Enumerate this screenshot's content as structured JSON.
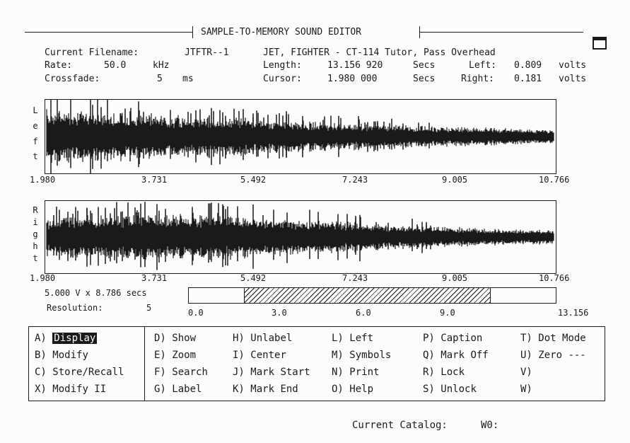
{
  "header": {
    "title": "SAMPLE-TO-MEMORY SOUND EDITOR"
  },
  "info": {
    "filename_label": "Current Filename:",
    "filename_value": "JTFTR--1",
    "description": "JET, FIGHTER - CT-114 Tutor, Pass Overhead",
    "rate_label": "Rate:",
    "rate_value": "50.0",
    "rate_unit": "kHz",
    "length_label": "Length:",
    "length_value": "13.156 920",
    "length_unit": "Secs",
    "left_label": "Left:",
    "left_value": "0.809",
    "left_unit": "volts",
    "crossfade_label": "Crossfade:",
    "crossfade_value": "5",
    "crossfade_unit": "ms",
    "cursor_label": "Cursor:",
    "cursor_value": "1.980 000",
    "cursor_unit": "Secs",
    "right_label": "Right:",
    "right_value": "0.181",
    "right_unit": "volts"
  },
  "channels": {
    "left_letters": [
      "L",
      "e",
      "f",
      "t"
    ],
    "right_letters": [
      "R",
      "i",
      "g",
      "h",
      "t"
    ],
    "ticks": [
      "1.980",
      "3.731",
      "5.492",
      "7.243",
      "9.005",
      "10.766"
    ]
  },
  "overview": {
    "scale_text": "5.000 V x 8.786 secs",
    "resolution_label": "Resolution:",
    "resolution_value": "5",
    "ticks": [
      "0.0",
      "3.0",
      "6.0",
      "9.0",
      "13.156"
    ],
    "total": 13.156,
    "view_start": 1.98,
    "view_end": 10.766
  },
  "menu": {
    "columns": [
      [
        {
          "key": "A)",
          "label": "Display",
          "selected": true
        },
        {
          "key": "B)",
          "label": "Modify"
        },
        {
          "key": "C)",
          "label": "Store/Recall"
        },
        {
          "key": "X)",
          "label": "Modify II"
        }
      ],
      [
        {
          "key": "D)",
          "label": "Show"
        },
        {
          "key": "E)",
          "label": "Zoom"
        },
        {
          "key": "F)",
          "label": "Search"
        },
        {
          "key": "G)",
          "label": "Label"
        }
      ],
      [
        {
          "key": "H)",
          "label": "Unlabel"
        },
        {
          "key": "I)",
          "label": "Center"
        },
        {
          "key": "J)",
          "label": "Mark Start"
        },
        {
          "key": "K)",
          "label": "Mark End"
        }
      ],
      [
        {
          "key": "L)",
          "label": "Left"
        },
        {
          "key": "M)",
          "label": "Symbols"
        },
        {
          "key": "N)",
          "label": "Print"
        },
        {
          "key": "O)",
          "label": "Help"
        }
      ],
      [
        {
          "key": "P)",
          "label": "Caption"
        },
        {
          "key": "Q)",
          "label": "Mark Off"
        },
        {
          "key": "R)",
          "label": "Lock"
        },
        {
          "key": "S)",
          "label": "Unlock"
        }
      ],
      [
        {
          "key": "T)",
          "label": "Dot Mode"
        },
        {
          "key": "U)",
          "label": "Zero ---"
        },
        {
          "key": "V)",
          "label": ""
        },
        {
          "key": "W)",
          "label": ""
        }
      ]
    ]
  },
  "footer": {
    "catalog_label": "Current Catalog:",
    "catalog_value": "W0:"
  },
  "colors": {
    "ink": "#1a1a1a",
    "paper": "#fcfcfa"
  }
}
